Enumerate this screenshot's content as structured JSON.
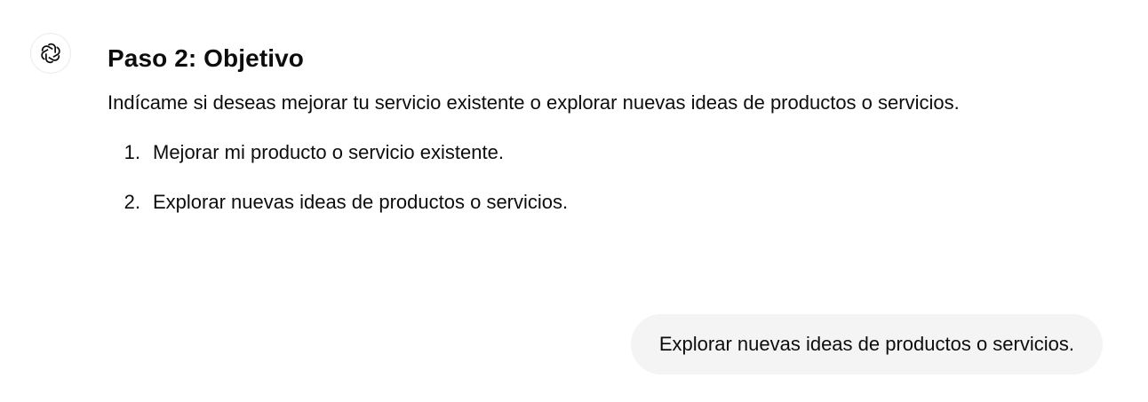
{
  "assistant": {
    "avatar_icon": "openai-logo-icon",
    "heading": "Paso 2: Objetivo",
    "description": "Indícame si deseas mejorar tu servicio existente o explorar nuevas ideas de productos o servicios.",
    "options": [
      {
        "number": "1.",
        "text": "Mejorar mi producto o servicio existente."
      },
      {
        "number": "2.",
        "text": "Explorar nuevas ideas de productos o servicios."
      }
    ]
  },
  "user": {
    "message": "Explorar nuevas ideas de productos o servicios."
  },
  "colors": {
    "text": "#0d0d0d",
    "user_bubble_bg": "#f4f4f4",
    "avatar_border": "#ececec"
  }
}
